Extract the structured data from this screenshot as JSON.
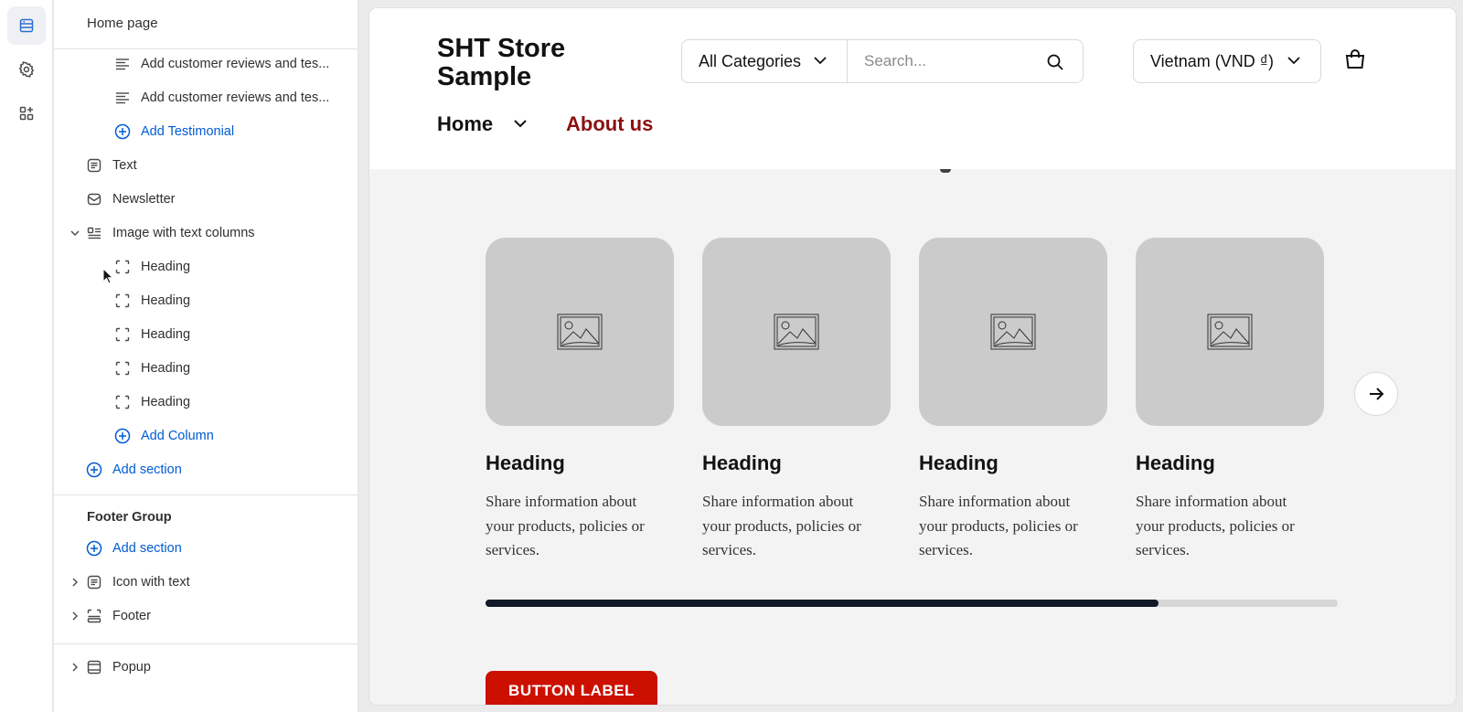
{
  "rail": {
    "items": [
      "sections-icon",
      "settings-icon",
      "apps-icon"
    ]
  },
  "sidebar": {
    "title": "Home page",
    "rows": [
      {
        "label": "Add customer reviews and tes...",
        "icon": "text-lines-icon"
      },
      {
        "label": "Add customer reviews and tes...",
        "icon": "text-lines-icon"
      },
      {
        "label": "Add Testimonial",
        "icon": "plus-circle-icon"
      },
      {
        "label": "Text",
        "icon": "text-block-icon"
      },
      {
        "label": "Newsletter",
        "icon": "envelope-icon"
      },
      {
        "label": "Image with text columns",
        "icon": "columns-icon"
      },
      {
        "label": "Heading",
        "icon": "frame-icon"
      },
      {
        "label": "Heading",
        "icon": "frame-icon"
      },
      {
        "label": "Heading",
        "icon": "frame-icon"
      },
      {
        "label": "Heading",
        "icon": "frame-icon"
      },
      {
        "label": "Heading",
        "icon": "frame-icon"
      },
      {
        "label": "Add Column",
        "icon": "plus-circle-icon"
      },
      {
        "label": "Add section",
        "icon": "plus-circle-icon"
      }
    ],
    "footer_group": {
      "title": "Footer Group",
      "add_section": "Add section",
      "rows": [
        {
          "label": "Icon with text",
          "icon": "text-block-icon"
        },
        {
          "label": "Footer",
          "icon": "footer-icon"
        }
      ]
    },
    "popup": {
      "label": "Popup",
      "icon": "popup-icon"
    }
  },
  "preview": {
    "logo": "SHT Store Sample",
    "category": "All Categories",
    "search_placeholder": "Search...",
    "country": "Vietnam (VND ₫)",
    "nav": {
      "home": "Home",
      "about": "About us"
    },
    "columns": [
      {
        "heading": "Heading",
        "text": "Share information about your products, policies or services."
      },
      {
        "heading": "Heading",
        "text": "Share information about your products, policies or services."
      },
      {
        "heading": "Heading",
        "text": "Share information about your products, policies or services."
      },
      {
        "heading": "Heading",
        "text": "Share information about your products, policies or services."
      }
    ],
    "scroll_progress": 0.79,
    "button_label": "BUTTON LABEL",
    "colors": {
      "accent_nav": "#8b1111",
      "button": "#cc1000",
      "scroll_fill": "#111827",
      "link_blue": "#005bd3"
    }
  }
}
